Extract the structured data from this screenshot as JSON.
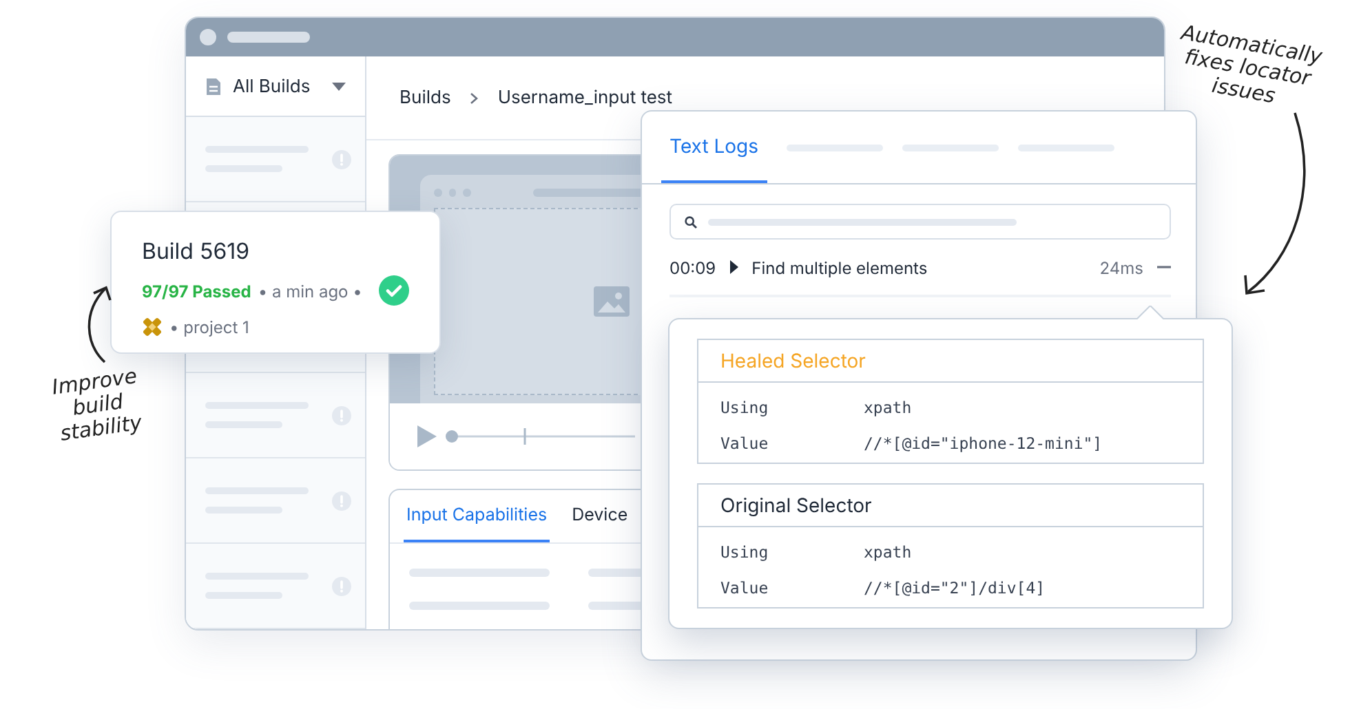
{
  "window": {
    "sidebar_dropdown": "All Builds",
    "player": {
      "level": 0
    },
    "breadcrumb": [
      "Builds",
      "Username_input test"
    ],
    "bottom_tabs": [
      {
        "label": "Input Capabilities",
        "selected": true
      },
      {
        "label": "Device",
        "selected": false
      }
    ]
  },
  "build_card": {
    "title": "Build 5619",
    "result": "97/97 Passed",
    "time": "• a min ago •",
    "project": "• project 1",
    "passed": true
  },
  "logs": {
    "tabs": [
      {
        "label": "Text Logs",
        "selected": true
      }
    ],
    "entry": {
      "time": "00:09",
      "name": "Find multiple elements",
      "duration": "24ms",
      "expanded": true
    }
  },
  "selectors": [
    {
      "title": "Healed Selector",
      "kind": "healed",
      "rows": [
        {
          "label": "Using",
          "value": "xpath"
        },
        {
          "label": "Value",
          "value": "//*[@id=\"iphone-12-mini\"]"
        }
      ]
    },
    {
      "title": "Original Selector",
      "kind": "original",
      "rows": [
        {
          "label": "Using",
          "value": "xpath"
        },
        {
          "label": "Value",
          "value": "//*[@id=\"2\"]/div[4]"
        }
      ]
    }
  ],
  "annotations": [
    {
      "lines": [
        "Improve",
        "build",
        "stability"
      ]
    },
    {
      "lines": [
        "Automatically",
        "fixes locator",
        "issues"
      ]
    }
  ]
}
